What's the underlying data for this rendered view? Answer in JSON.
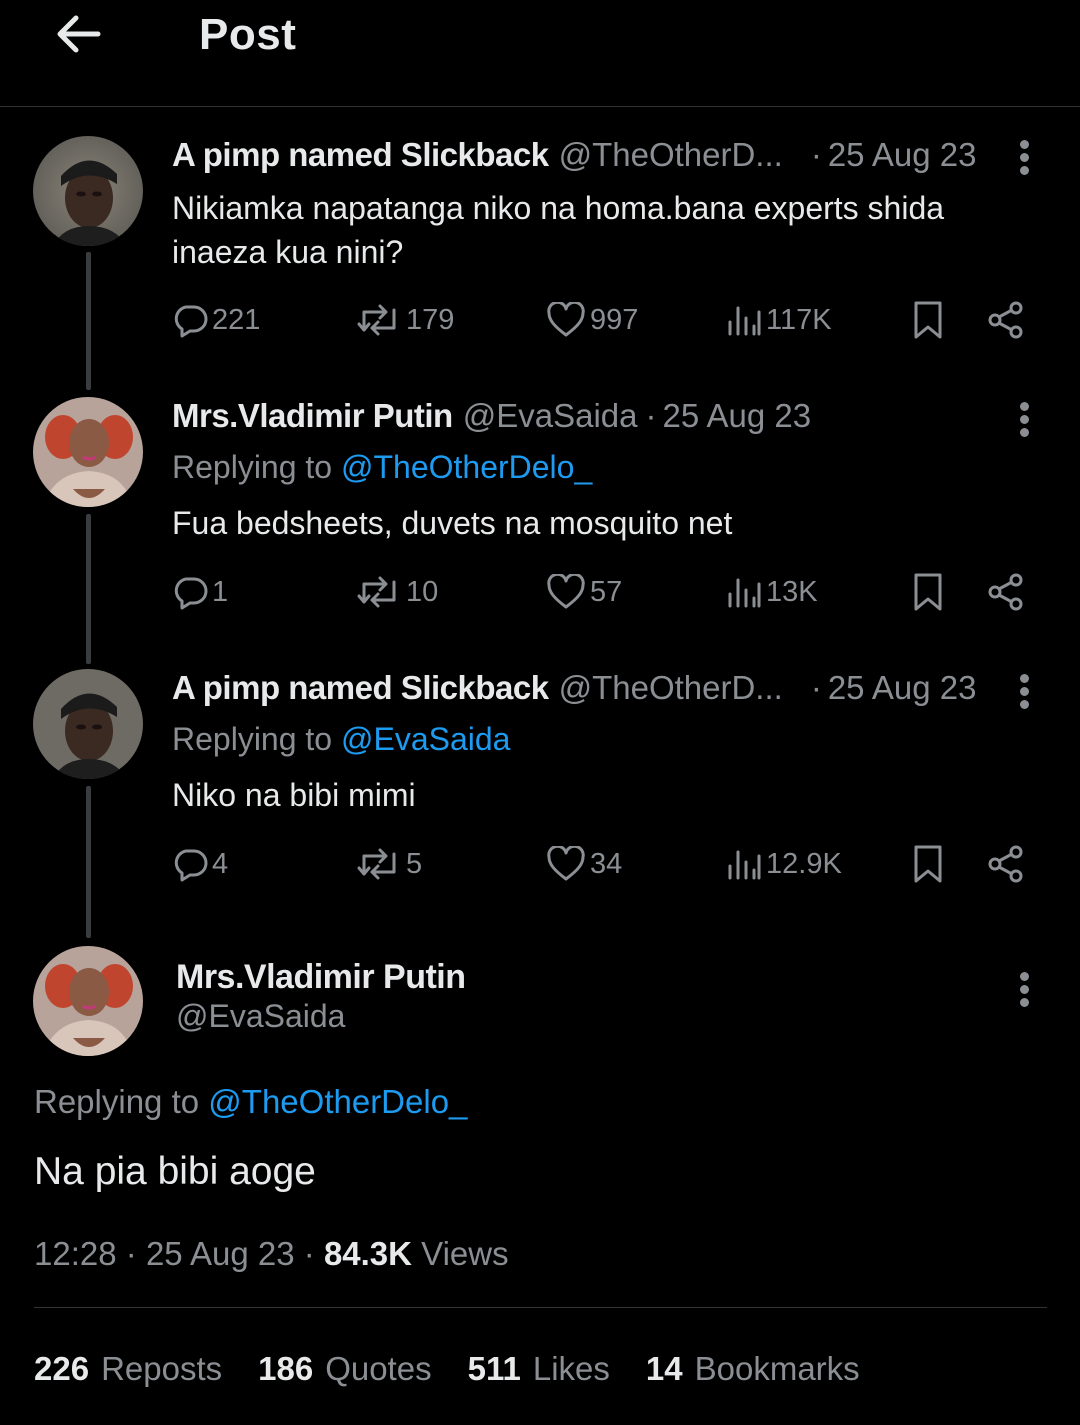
{
  "header": {
    "title": "Post",
    "back_icon": "arrow-left-icon"
  },
  "thread": [
    {
      "name": "A pimp named Slickback",
      "handle": "@TheOtherD...",
      "date": "25 Aug 23",
      "replying_prefix": "",
      "replying_mention": "",
      "text": "Nikiamka napatanga niko na homa.bana experts shida inaeza kua nini?",
      "replies": "221",
      "reposts": "179",
      "likes": "997",
      "views": "117K"
    },
    {
      "name": "Mrs.Vladimir Putin",
      "handle": "@EvaSaida",
      "date": "25 Aug 23",
      "replying_prefix": "Replying to",
      "replying_mention": "@TheOtherDelo_",
      "text": "Fua bedsheets, duvets na mosquito net",
      "replies": "1",
      "reposts": "10",
      "likes": "57",
      "views": "13K"
    },
    {
      "name": "A pimp named Slickback",
      "handle": "@TheOtherD...",
      "date": "25 Aug 23",
      "replying_prefix": "Replying to",
      "replying_mention": "@EvaSaida",
      "text": "Niko na bibi mimi",
      "replies": "4",
      "reposts": "5",
      "likes": "34",
      "views": "12.9K"
    }
  ],
  "main": {
    "name": "Mrs.Vladimir Putin",
    "handle": "@EvaSaida",
    "replying_prefix": "Replying to",
    "replying_mention": "@TheOtherDelo_",
    "text": "Na pia bibi aoge",
    "time": "12:28",
    "date": "25 Aug 23",
    "views_count": "84.3K",
    "views_label": "Views",
    "reposts_count": "226",
    "reposts_label": "Reposts",
    "quotes_count": "186",
    "quotes_label": "Quotes",
    "likes_count": "511",
    "likes_label": "Likes",
    "bookmarks_count": "14",
    "bookmarks_label": "Bookmarks"
  },
  "colors": {
    "background": "#000000",
    "text": "#e7e9ea",
    "muted": "#8b8f94",
    "link": "#1d9bf0"
  }
}
